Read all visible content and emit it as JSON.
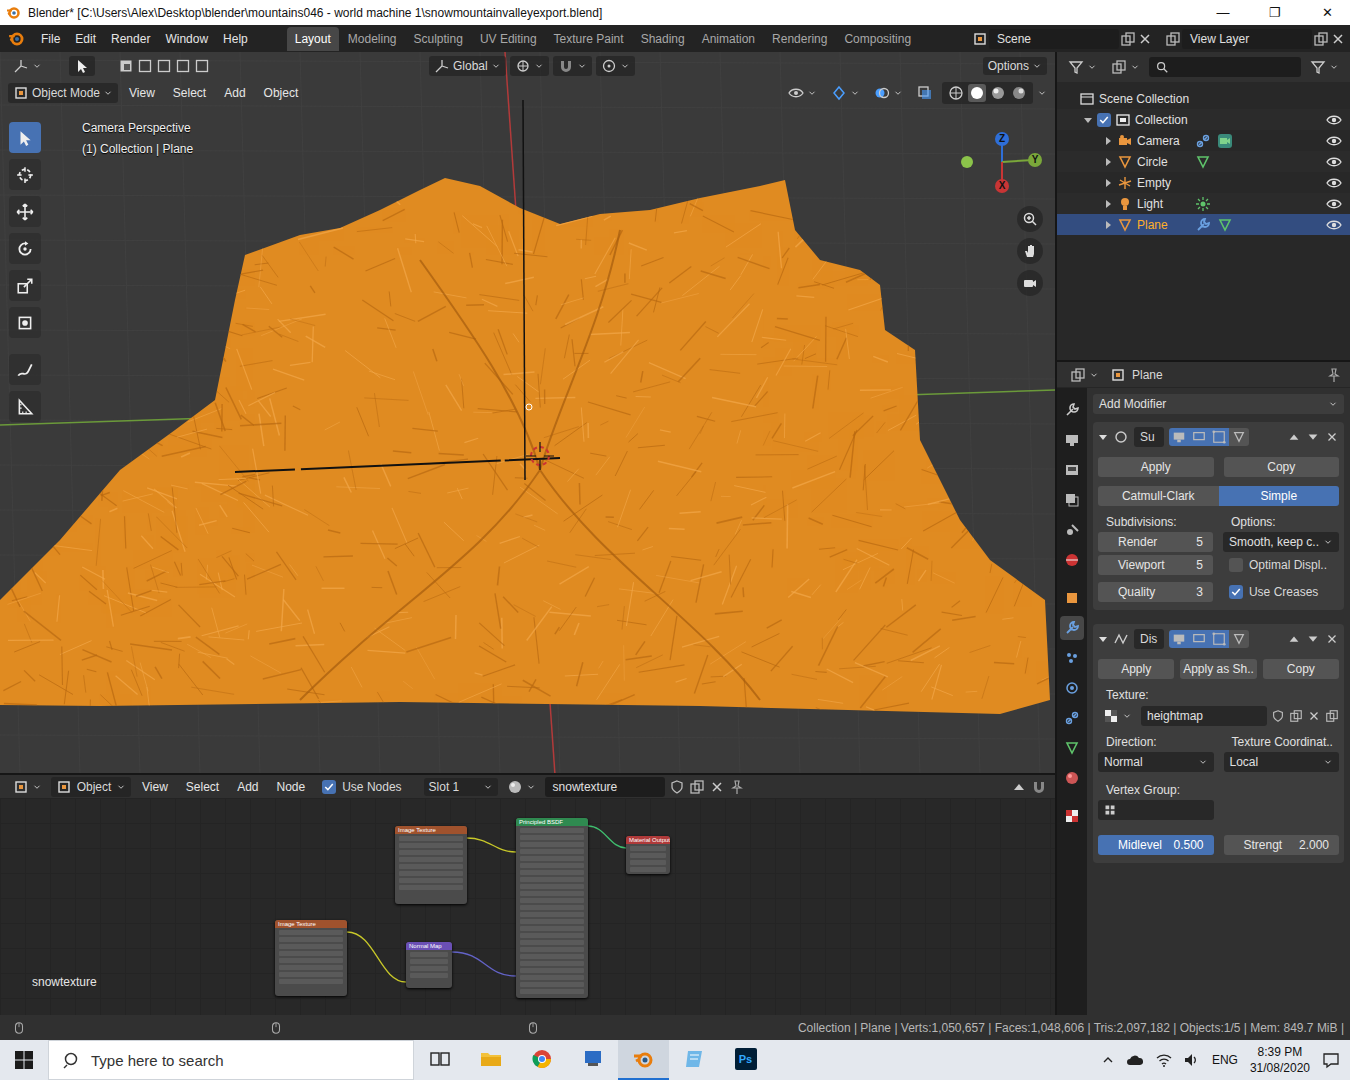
{
  "window": {
    "title": "Blender* [C:\\Users\\Alex\\Desktop\\blender\\mountains046 - world machine 1\\snowmountainvalleyexport.blend]",
    "controls": [
      "—",
      "❐",
      "✕"
    ]
  },
  "topbar": {
    "menus": [
      "File",
      "Edit",
      "Render",
      "Window",
      "Help"
    ],
    "workspaces": [
      {
        "label": "Layout",
        "selected": true
      },
      {
        "label": "Modeling",
        "selected": false
      },
      {
        "label": "Sculpting",
        "selected": false
      },
      {
        "label": "UV Editing",
        "selected": false
      },
      {
        "label": "Texture Paint",
        "selected": false
      },
      {
        "label": "Shading",
        "selected": false
      },
      {
        "label": "Animation",
        "selected": false
      },
      {
        "label": "Rendering",
        "selected": false
      },
      {
        "label": "Compositing",
        "selected": false
      }
    ],
    "scene": "Scene",
    "view_layer": "View Layer"
  },
  "viewport": {
    "transform_orientation": "Global",
    "options": "Options",
    "mode": "Object Mode",
    "menus": [
      "View",
      "Select",
      "Add",
      "Object"
    ],
    "info": [
      "Camera Perspective",
      "(1) Collection | Plane"
    ],
    "axes": {
      "x": "X",
      "y": "Y",
      "z": "Z"
    },
    "tools": [
      {
        "kind": "select",
        "selected": true
      },
      {
        "kind": "cursor",
        "selected": false
      },
      {
        "kind": "move",
        "selected": false
      },
      {
        "kind": "rotate",
        "selected": false
      },
      {
        "kind": "scale",
        "selected": false
      },
      {
        "kind": "transform",
        "selected": false
      },
      {
        "kind": "annotate",
        "selected": false
      },
      {
        "kind": "measure",
        "selected": false
      }
    ],
    "shading": [
      {
        "kind": "wireframe",
        "selected": false
      },
      {
        "kind": "solid",
        "selected": true
      },
      {
        "kind": "material",
        "selected": false
      },
      {
        "kind": "rendered",
        "selected": false
      }
    ]
  },
  "outliner": {
    "items": [
      {
        "label": "Scene Collection",
        "kind": "scene",
        "selected": false,
        "expanded": true,
        "extras": []
      },
      {
        "label": "Collection",
        "kind": "collection",
        "selected": false,
        "expanded": true,
        "checked": true,
        "visible": true,
        "extras": []
      },
      {
        "label": "Camera",
        "kind": "camera",
        "selected": false,
        "expanded": false,
        "visible": true,
        "extras": [
          "constraint",
          "camera-data"
        ]
      },
      {
        "label": "Circle",
        "kind": "mesh",
        "selected": false,
        "expanded": false,
        "visible": true,
        "extras": [
          "mesh-data"
        ]
      },
      {
        "label": "Empty",
        "kind": "empty",
        "selected": false,
        "expanded": false,
        "visible": true,
        "extras": []
      },
      {
        "label": "Light",
        "kind": "light",
        "selected": false,
        "expanded": false,
        "visible": true,
        "extras": [
          "light-data"
        ]
      },
      {
        "label": "Plane",
        "kind": "mesh",
        "selected": true,
        "expanded": false,
        "visible": true,
        "extras": [
          "modifier",
          "mesh-data"
        ]
      }
    ]
  },
  "properties": {
    "object": "Plane",
    "add_modifier": "Add Modifier",
    "tabs": [
      {
        "kind": "tool",
        "selected": false
      },
      {
        "kind": "render",
        "selected": false
      },
      {
        "kind": "output",
        "selected": false
      },
      {
        "kind": "view-layer",
        "selected": false
      },
      {
        "kind": "scene",
        "selected": false
      },
      {
        "kind": "world",
        "selected": false
      },
      {
        "kind": "object",
        "selected": false
      },
      {
        "kind": "modifier",
        "selected": true
      },
      {
        "kind": "particles",
        "selected": false
      },
      {
        "kind": "physics",
        "selected": false
      },
      {
        "kind": "constraints",
        "selected": false
      },
      {
        "kind": "data",
        "selected": false
      },
      {
        "kind": "material",
        "selected": false
      },
      {
        "kind": "texture",
        "selected": false
      }
    ],
    "subdivision": {
      "name": "Su",
      "expanded": true,
      "apply": "Apply",
      "copy": "Copy",
      "types": [
        {
          "label": "Catmull-Clark",
          "selected": false
        },
        {
          "label": "Simple",
          "selected": true
        }
      ],
      "subdivisions_label": "Subdivisions:",
      "options_label": "Options:",
      "fields": [
        {
          "label": "Render",
          "value": "5"
        },
        {
          "label": "Viewport",
          "value": "5"
        },
        {
          "label": "Quality",
          "value": "3"
        }
      ],
      "uv_smooth": "Smooth, keep c..",
      "checks": [
        {
          "label": "Optimal Displ..",
          "checked": false
        },
        {
          "label": "Use Creases",
          "checked": true
        }
      ]
    },
    "displace": {
      "name": "Dis",
      "expanded": true,
      "buttons": [
        "Apply",
        "Apply as Sh..",
        "Copy"
      ],
      "texture_label": "Texture:",
      "texture": "heightmap",
      "direction_label": "Direction:",
      "coords_label": "Texture Coordinat..",
      "direction": "Normal",
      "coords": "Local",
      "vertex_group_label": "Vertex Group:",
      "midlevel": {
        "label": "Midlevel",
        "value": "0.500",
        "selected": true
      },
      "strength": {
        "label": "Strengt",
        "value": "2.000",
        "selected": false
      }
    }
  },
  "node_editor": {
    "editor": "Object",
    "menus": [
      "View",
      "Select",
      "Add",
      "Node"
    ],
    "use_nodes": {
      "label": "Use Nodes",
      "checked": true
    },
    "slot": "Slot 1",
    "material": "snowtexture",
    "label": "snowtexture",
    "nodes": [
      {
        "title": "Image Texture",
        "color": "#a0522d"
      },
      {
        "title": "Principled BSDF",
        "color": "#2f8a50"
      },
      {
        "title": "Material Output",
        "color": "#b03a3a"
      },
      {
        "title": "Image Texture",
        "color": "#a0522d"
      },
      {
        "title": "Normal Map",
        "color": "#6a4fb5"
      }
    ]
  },
  "status_bar": {
    "text": "Collection | Plane | Verts:1,050,657 | Faces:1,048,606 | Tris:2,097,182 | Objects:1/5 | Mem: 849.7 MiB |"
  },
  "taskbar": {
    "search": "Type here to search",
    "apps": [
      {
        "kind": "task-view",
        "active": false
      },
      {
        "kind": "file-explorer",
        "active": false
      },
      {
        "kind": "chrome",
        "active": false
      },
      {
        "kind": "app",
        "active": false
      },
      {
        "kind": "blender",
        "active": true
      },
      {
        "kind": "notes",
        "active": false
      },
      {
        "kind": "photoshop",
        "active": false,
        "label": "Ps"
      }
    ],
    "language": "ENG",
    "time": "8:39 PM",
    "date": "31/08/2020"
  }
}
